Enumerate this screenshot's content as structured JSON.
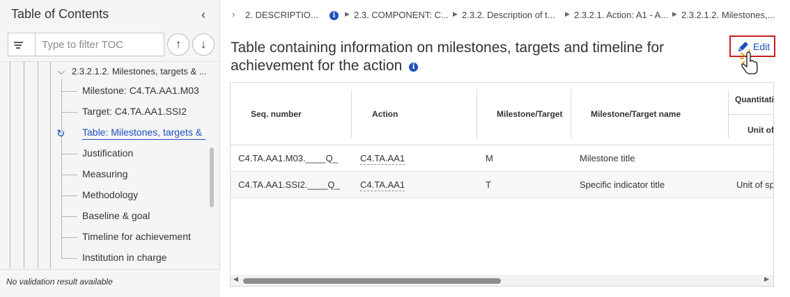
{
  "toc": {
    "title": "Table of Contents",
    "collapse_icon": "‹",
    "filter_placeholder": "Type to filter TOC",
    "up_icon": "↑",
    "down_icon": "↓",
    "parent_item": "2.3.2.1.2. Milestones, targets & ...",
    "items": [
      "Milestone: C4.TA.AA1.M03",
      "Target: C4.TA.AA1.SSI2",
      "Table: Milestones, targets & ...",
      "Justification",
      "Measuring",
      "Methodology",
      "Baseline & goal",
      "Timeline for achievement",
      "Institution in charge"
    ],
    "footer": "No validation result available"
  },
  "breadcrumb": [
    "2. DESCRIPTIO...",
    "2.3. COMPONENT: C...",
    "2.3.2. Description of t...",
    "2.3.2.1. Action: A1 - A...",
    "2.3.2.1.2. Milestones,..."
  ],
  "section": {
    "title_line1": "Table containing information on milestones, targets and timeline for",
    "title_line2": "achievement for the action",
    "edit_label": "Edit"
  },
  "table": {
    "headers": [
      "Seq. number",
      "Action",
      "Milestone/Target",
      "Milestone/Target name",
      "Quantitati",
      "Unit of"
    ],
    "rows": [
      [
        "C4.TA.AA1.M03.____Q_",
        "C4.TA.AA1",
        "M",
        "Milestone title",
        ""
      ],
      [
        "C4.TA.AA1.SSI2.____Q_",
        "C4.TA.AA1",
        "T",
        "Specific indicator title",
        "Unit of sp"
      ]
    ]
  },
  "colors": {
    "accent": "#1d4fbf",
    "edit_border": "#c81e1e"
  }
}
